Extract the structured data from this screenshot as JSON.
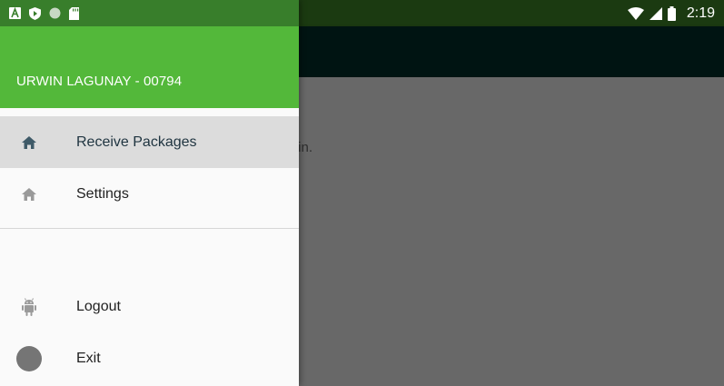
{
  "status_bar": {
    "time": "2:19",
    "left_icons": [
      "a-box-icon",
      "shield-icon",
      "circle-icon",
      "sd-card-icon"
    ],
    "right_icons": [
      "wifi-icon",
      "signal-icon",
      "battery-icon"
    ]
  },
  "background_app": {
    "body_text": "ck in."
  },
  "drawer": {
    "username": "URWIN LAGUNAY - 00794",
    "primary_items": [
      {
        "label": "Receive Packages",
        "icon": "home-icon",
        "selected": true
      },
      {
        "label": "Settings",
        "icon": "home-icon",
        "selected": false
      }
    ],
    "secondary_items": [
      {
        "label": "Logout",
        "icon": "android-icon"
      },
      {
        "label": "Exit",
        "icon": "circle-icon"
      }
    ]
  },
  "colors": {
    "header_green": "#53b83a",
    "statusbar_green": "#387e2b",
    "selected_item_bg": "#dcdcdc",
    "scrim": "#6b6b6b"
  }
}
